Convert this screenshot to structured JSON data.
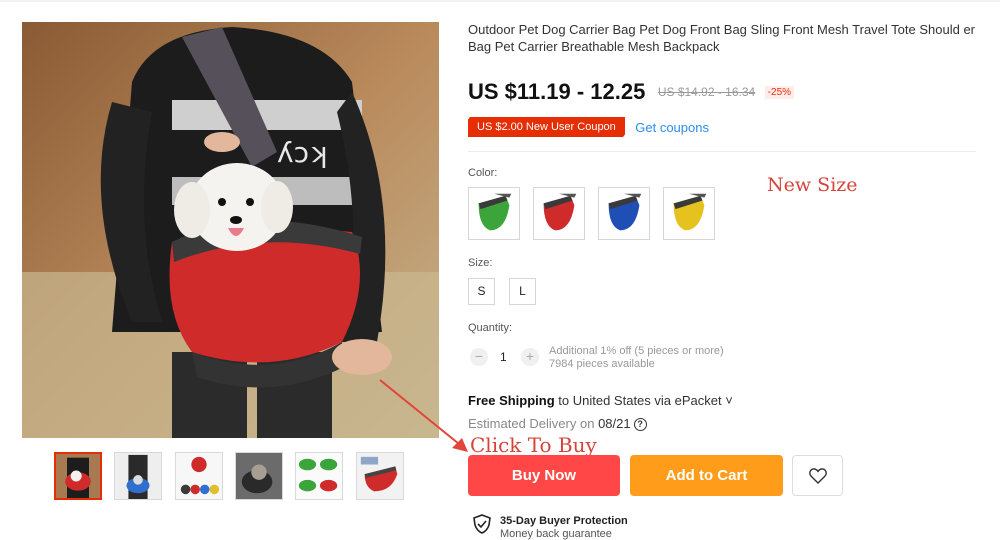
{
  "product": {
    "title": "Outdoor Pet Dog Carrier Bag Pet Dog Front Bag Sling Front Mesh Travel Tote Should er Bag Pet Carrier Breathable Mesh Backpack",
    "price": "US $11.19 - 12.25",
    "original_price": "US $14.92 - 16.34",
    "discount": "-25%",
    "coupon": "US $2.00 New User Coupon",
    "get_coupons": "Get coupons"
  },
  "options": {
    "color_label": "Color:",
    "colors": [
      "green",
      "red",
      "blue",
      "yellow"
    ],
    "annotation_new_size": "New Size",
    "size_label": "Size:",
    "sizes": [
      "S",
      "L"
    ],
    "quantity_label": "Quantity:",
    "quantity_value": "1",
    "quantity_minus": "−",
    "quantity_plus": "+",
    "quantity_note_1": "Additional 1% off (5 pieces or more)",
    "quantity_note_2": "7984 pieces available"
  },
  "shipping": {
    "free_label": "Free Shipping",
    "destination": " to United States via ePacket ˅",
    "estimated_label": "Estimated Delivery on ",
    "estimated_date": "08/21",
    "help_glyph": "?"
  },
  "actions": {
    "annotation_click_to_buy": "Click To Buy",
    "buy_now": "Buy Now",
    "add_to_cart": "Add to Cart",
    "wishlist_icon": "heart-icon"
  },
  "protection": {
    "title": "35-Day Buyer Protection",
    "subtitle": "Money back guarantee"
  },
  "gallery": {
    "thumbnail_count": 6,
    "active_index": 0
  },
  "colors": {
    "accent_red": "#ff4747",
    "cart_orange": "#ff9c1a",
    "coupon_red": "#e62e04",
    "link_blue": "#2d8cf0",
    "annotation_red": "#d5443a"
  }
}
